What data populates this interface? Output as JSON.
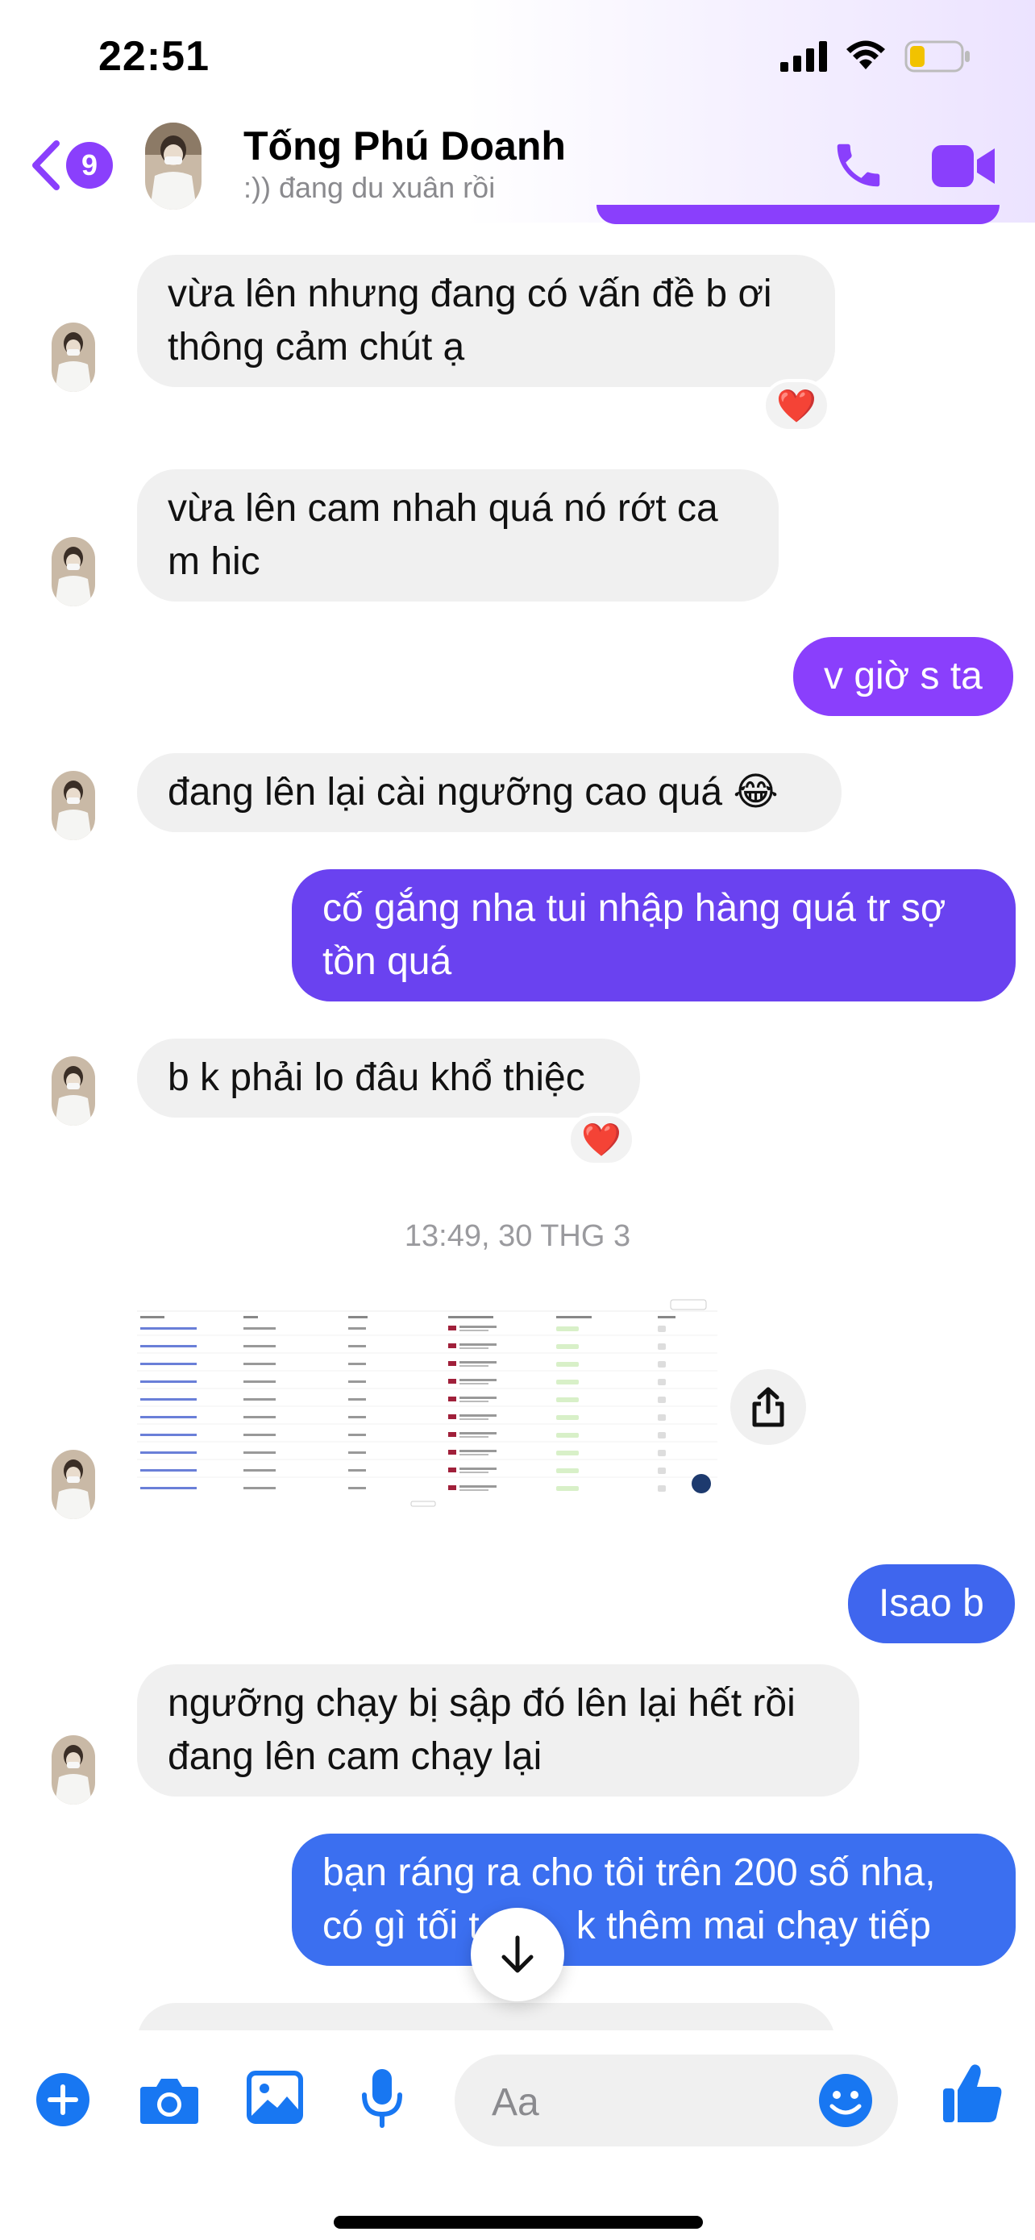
{
  "status_bar": {
    "time": "22:51"
  },
  "header": {
    "back_badge": "9",
    "name": "Tống Phú Doanh",
    "status": ":)) đang du xuân rồi",
    "accent_color": "#8a3ffc"
  },
  "messages": [
    {
      "from": "them",
      "text_line1": "vừa lên nhưng đang có vấn đề b ơi",
      "text_line2": "thông cảm chút ạ",
      "reaction": "❤️"
    },
    {
      "from": "them",
      "text_line1": "vừa lên cam nhah quá nó rớt ca",
      "text_line2": "m hic"
    },
    {
      "from": "me",
      "text": "v giờ s ta"
    },
    {
      "from": "them",
      "text": "đang lên lại cài ngưỡng cao quá 😂"
    },
    {
      "from": "me",
      "text_line1": "cố gắng nha tui nhập hàng quá tr sợ",
      "text_line2": "tồn quá"
    },
    {
      "from": "them",
      "text": "b k phải lo đâu khổ thiệc",
      "reaction": "❤️"
    },
    {
      "from": "them",
      "type": "image",
      "description_icon": "spreadsheet-screenshot"
    },
    {
      "from": "me",
      "text": "Isao b"
    },
    {
      "from": "them",
      "text_line1": "ngưỡng chạy bị sập đó lên lại hết rồi",
      "text_line2": "đang lên cam chạy lại"
    },
    {
      "from": "me",
      "text_line1": "bạn ráng ra cho tôi trên 200 số nha,",
      "text_line2": "có gì tối t",
      "text_line2_after": "k thêm mai chạy tiếp"
    }
  ],
  "timestamp": "13:49, 30 THG 3",
  "composer": {
    "placeholder": "Aa",
    "icons": [
      "plus-icon",
      "camera-icon",
      "image-icon",
      "microphone-icon",
      "emoji-icon",
      "thumbs-up-icon"
    ]
  },
  "colors": {
    "incoming_bubble": "#f0f0f0",
    "out_purple": "#8a3ffc",
    "out_violet": "#6a42f0",
    "out_blue": "#3b6ff0",
    "composer_icon": "#1877f2"
  }
}
